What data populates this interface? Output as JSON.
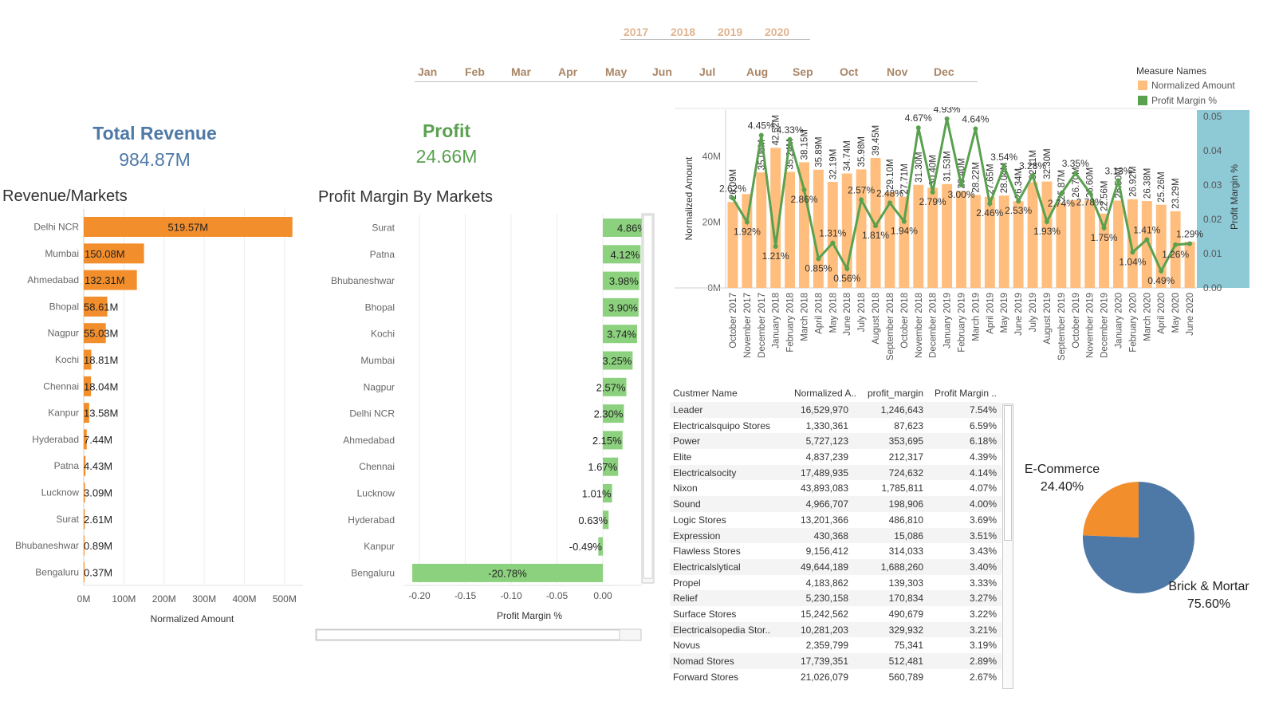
{
  "filters": {
    "years": [
      "2017",
      "2018",
      "2019",
      "2020"
    ],
    "months": [
      "Jan",
      "Feb",
      "Mar",
      "Apr",
      "May",
      "Jun",
      "Jul",
      "Aug",
      "Sep",
      "Oct",
      "Nov",
      "Dec"
    ]
  },
  "kpis": {
    "revenue_title": "Total Revenue",
    "revenue_value": "984.87M",
    "profit_title": "Profit",
    "profit_value": "24.66M"
  },
  "colors": {
    "revenue_bar": "#f28e2b",
    "margin_bar": "#8cd17d",
    "normalized_amount": "#ffbe7d",
    "profit_margin_line": "#59a14f",
    "revenue_title": "#4e79a7",
    "profit_title": "#59a14f",
    "ecommerce": "#f28e2b",
    "brick_mortar": "#4e79a7",
    "right_axis_band": "#8ec9d6"
  },
  "chart_data": [
    {
      "type": "bar",
      "title": "Revenue/Markets",
      "orientation": "horizontal",
      "xlabel": "Normalized Amount",
      "xlim": [
        0,
        540
      ],
      "xticks": [
        "0M",
        "100M",
        "200M",
        "300M",
        "400M",
        "500M"
      ],
      "categories": [
        "Delhi NCR",
        "Mumbai",
        "Ahmedabad",
        "Bhopal",
        "Nagpur",
        "Kochi",
        "Chennai",
        "Kanpur",
        "Hyderabad",
        "Patna",
        "Lucknow",
        "Surat",
        "Bhubaneshwar",
        "Bengaluru"
      ],
      "values": [
        519.57,
        150.08,
        132.31,
        58.61,
        55.03,
        18.81,
        18.04,
        13.58,
        7.44,
        4.43,
        3.09,
        2.61,
        0.89,
        0.37
      ],
      "labels": [
        "519.57M",
        "150.08M",
        "132.31M",
        "58.61M",
        "55.03M",
        "18.81M",
        "18.04M",
        "13.58M",
        "7.44M",
        "4.43M",
        "3.09M",
        "2.61M",
        "0.89M",
        "0.37M"
      ]
    },
    {
      "type": "bar",
      "title": "Profit Margin By Markets",
      "orientation": "horizontal",
      "xlabel": "Profit Margin %",
      "xlim": [
        -0.21,
        0.04
      ],
      "xticks": [
        "-0.20",
        "-0.15",
        "-0.10",
        "-0.05",
        "0.00"
      ],
      "categories": [
        "Surat",
        "Patna",
        "Bhubaneshwar",
        "Bhopal",
        "Kochi",
        "Mumbai",
        "Nagpur",
        "Delhi NCR",
        "Ahmedabad",
        "Chennai",
        "Lucknow",
        "Hyderabad",
        "Kanpur",
        "Bengaluru"
      ],
      "values": [
        0.0486,
        0.0412,
        0.0398,
        0.039,
        0.0374,
        0.0325,
        0.0257,
        0.023,
        0.0215,
        0.0167,
        0.0101,
        0.0063,
        -0.0049,
        -0.2078
      ],
      "labels": [
        "4.86%",
        "4.12%",
        "3.98%",
        "3.90%",
        "3.74%",
        "3.25%",
        "2.57%",
        "2.30%",
        "2.15%",
        "1.67%",
        "1.01%",
        "0.63%",
        "-0.49%",
        "-20.78%"
      ]
    },
    {
      "type": "bar",
      "title": "",
      "ylabel": "Normalized Amount",
      "y2label": "Profit Margin %",
      "ylim": [
        0,
        54
      ],
      "y2lim": [
        0,
        0.05
      ],
      "yticks": [
        "0M",
        "20M",
        "40M"
      ],
      "y2ticks": [
        "0.00",
        "0.01",
        "0.02",
        "0.03",
        "0.04",
        "0.05"
      ],
      "legend": "top-right",
      "legend_title": "Measure Names",
      "categories": [
        "October 2017",
        "November 2017",
        "December 2017",
        "January 2018",
        "February 2018",
        "March 2018",
        "April 2018",
        "May 2018",
        "June 2018",
        "July 2018",
        "August 2018",
        "September 2018",
        "October 2018",
        "November 2018",
        "December 2018",
        "January 2019",
        "February 2019",
        "March 2019",
        "April 2019",
        "May 2019",
        "June 2019",
        "July 2019",
        "August 2019",
        "September 2019",
        "October 2019",
        "November 2019",
        "December 2019",
        "January 2020",
        "February 2020",
        "March 2020",
        "April 2020",
        "May 2020",
        "June 2020"
      ],
      "series": [
        {
          "name": "Normalized Amount",
          "type": "bar",
          "values": [
            26.09,
            28.5,
            35.06,
            42.52,
            35.24,
            38.15,
            35.89,
            32.19,
            34.74,
            35.98,
            39.45,
            29.1,
            27.71,
            31.3,
            30.4,
            31.53,
            29.4,
            28.22,
            27.65,
            28.04,
            26.34,
            32.11,
            32.3,
            25.87,
            26.7,
            26.6,
            22.56,
            26.5,
            26.92,
            26.38,
            25.26,
            23.29,
            14.0
          ],
          "labels": [
            "26.09M",
            "",
            "35.06M",
            "42.52M",
            "35.24M",
            "38.15M",
            "35.89M",
            "32.19M",
            "34.74M",
            "35.98M",
            "39.45M",
            "29.10M",
            "27.71M",
            "31.30M",
            "30.40M",
            "31.53M",
            "29.40M",
            "28.22M",
            "27.65M",
            "28.04M",
            "26.34M",
            "32.11M",
            "32.30M",
            "25.87M",
            "26.70M",
            "26.60M",
            "22.56M",
            "26.50M",
            "26.92M",
            "26.38M",
            "25.26M",
            "23.29M",
            ""
          ]
        },
        {
          "name": "Profit Margin %",
          "type": "line",
          "axis": "right",
          "values": [
            0.0262,
            0.0192,
            0.0445,
            0.0121,
            0.0433,
            0.0286,
            0.0085,
            0.0131,
            0.0056,
            0.0257,
            0.0181,
            0.0248,
            0.0194,
            0.0467,
            0.0279,
            0.0493,
            0.03,
            0.0464,
            0.0246,
            0.0354,
            0.0253,
            0.0328,
            0.0193,
            0.0274,
            0.0335,
            0.0278,
            0.0175,
            0.0313,
            0.0104,
            0.0141,
            0.0049,
            0.0126,
            0.0129
          ],
          "labels": [
            "2.62%",
            "1.92%",
            "4.45%",
            "1.21%",
            "4.33%",
            "2.86%",
            "0.85%",
            "1.31%",
            "0.56%",
            "2.57%",
            "1.81%",
            "2.48%",
            "1.94%",
            "4.67%",
            "2.79%",
            "4.93%",
            "3.00%",
            "4.64%",
            "2.46%",
            "3.54%",
            "2.53%",
            "3.28%",
            "1.93%",
            "2.74%",
            "3.35%",
            "2.78%",
            "1.75%",
            "3.13%",
            "1.04%",
            "1.41%",
            "0.49%",
            "1.26%",
            "1.29%"
          ]
        }
      ]
    },
    {
      "type": "table",
      "columns": [
        "Custmer Name",
        "Normalized A..",
        "profit_margin",
        "Profit Margin .."
      ],
      "rows": [
        [
          "Leader",
          "16,529,970",
          "1,246,643",
          "7.54%"
        ],
        [
          "Electricalsquipo Stores",
          "1,330,361",
          "87,623",
          "6.59%"
        ],
        [
          "Power",
          "5,727,123",
          "353,695",
          "6.18%"
        ],
        [
          "Elite",
          "4,837,239",
          "212,317",
          "4.39%"
        ],
        [
          "Electricalsocity",
          "17,489,935",
          "724,632",
          "4.14%"
        ],
        [
          "Nixon",
          "43,893,083",
          "1,785,811",
          "4.07%"
        ],
        [
          "Sound",
          "4,966,707",
          "198,906",
          "4.00%"
        ],
        [
          "Logic Stores",
          "13,201,366",
          "486,810",
          "3.69%"
        ],
        [
          "Expression",
          "430,368",
          "15,086",
          "3.51%"
        ],
        [
          "Flawless Stores",
          "9,156,412",
          "314,033",
          "3.43%"
        ],
        [
          "Electricalslytical",
          "49,644,189",
          "1,688,260",
          "3.40%"
        ],
        [
          "Propel",
          "4,183,862",
          "139,303",
          "3.33%"
        ],
        [
          "Relief",
          "5,230,158",
          "170,834",
          "3.27%"
        ],
        [
          "Surface Stores",
          "15,242,562",
          "490,679",
          "3.22%"
        ],
        [
          "Electricalsopedia Stor..",
          "10,281,203",
          "329,932",
          "3.21%"
        ],
        [
          "Novus",
          "2,359,799",
          "75,341",
          "3.19%"
        ],
        [
          "Nomad Stores",
          "17,739,351",
          "512,481",
          "2.89%"
        ],
        [
          "Forward Stores",
          "21,026,079",
          "560,789",
          "2.67%"
        ]
      ]
    },
    {
      "type": "pie",
      "title": "",
      "categories": [
        "E-Commerce",
        "Brick & Mortar"
      ],
      "values": [
        24.4,
        75.6
      ],
      "labels": [
        "24.40%",
        "75.60%"
      ]
    }
  ]
}
